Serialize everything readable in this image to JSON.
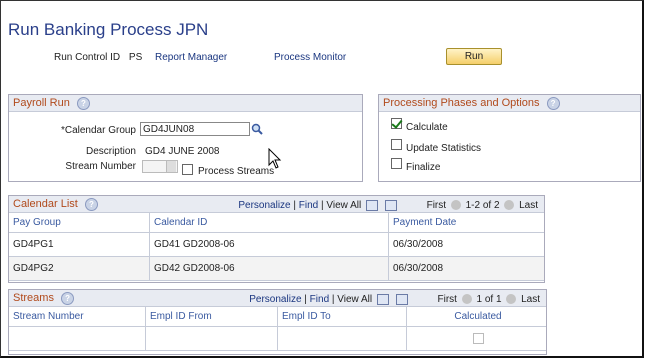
{
  "page": {
    "title": "Run Banking Process JPN"
  },
  "run_control": {
    "label": "Run Control ID",
    "value": "PS",
    "report_manager": "Report Manager",
    "process_monitor": "Process Monitor",
    "run_button": "Run"
  },
  "payroll_run": {
    "title": "Payroll Run",
    "calendar_group_label": "*Calendar Group",
    "calendar_group_value": "GD4JUN08",
    "description_label": "Description",
    "description_value": "GD4 JUNE 2008",
    "stream_number_label": "Stream Number",
    "process_streams_label": "Process Streams"
  },
  "phases": {
    "title": "Processing Phases and Options",
    "options": [
      {
        "label": "Calculate",
        "checked": true
      },
      {
        "label": "Update Statistics",
        "checked": false
      },
      {
        "label": "Finalize",
        "checked": false
      }
    ]
  },
  "calendar_list": {
    "title": "Calendar List",
    "personalize": "Personalize",
    "find": "Find",
    "view_all": "View All",
    "first": "First",
    "range": "1-2 of 2",
    "last": "Last",
    "columns": [
      "Pay Group",
      "Calendar ID",
      "Payment Date"
    ],
    "rows": [
      [
        "GD4PG1",
        "GD41 GD2008-06",
        "06/30/2008"
      ],
      [
        "GD4PG2",
        "GD42 GD2008-06",
        "06/30/2008"
      ]
    ]
  },
  "streams": {
    "title": "Streams",
    "personalize": "Personalize",
    "find": "Find",
    "view_all": "View All",
    "first": "First",
    "range": "1 of 1",
    "last": "Last",
    "columns": [
      "Stream Number",
      "Empl ID From",
      "Empl ID To",
      "Calculated"
    ]
  },
  "colors": {
    "title": "#2a3f8a",
    "section_title": "#b14a1c",
    "link": "#1a3680",
    "header_bg": "#e8ebf2"
  }
}
